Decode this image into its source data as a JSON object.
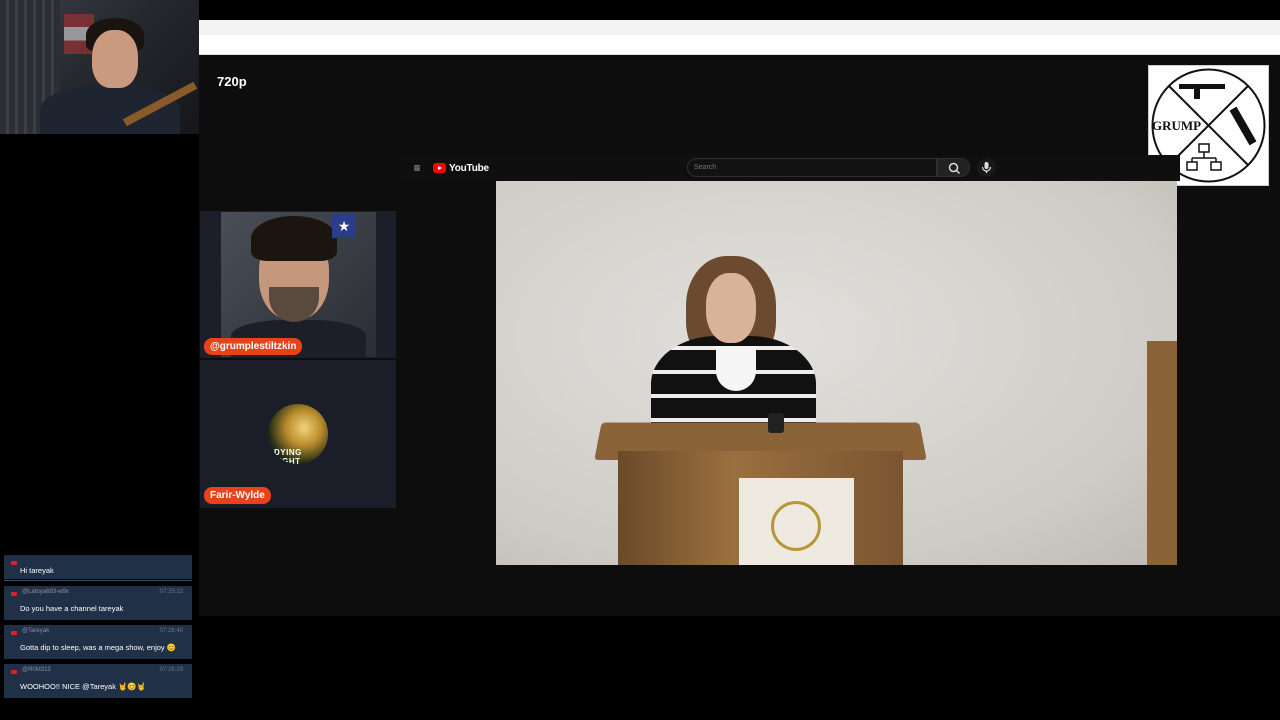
{
  "stream": {
    "quality_label": "720p"
  },
  "logo": {
    "text": "GRUMP"
  },
  "youtube": {
    "brand": "YouTube",
    "search_placeholder": "Search",
    "accent": "#ff0000"
  },
  "guests": [
    {
      "name": "@grumplestiltzkin",
      "avatar_text": ""
    },
    {
      "name": "Farir-Wylde",
      "avatar_text": "DYING LIGHT"
    }
  ],
  "chat": {
    "messages": [
      {
        "user": "",
        "time": "",
        "text": "Hi tareyak"
      },
      {
        "user": "@Latoya693-w9x",
        "time": "07:25:22",
        "text": "Do you have a channel tareyak"
      },
      {
        "user": "@Tareyak",
        "time": "07:26:40",
        "text": "Gotta dip to sleep, was a mega show, enjoy 😊"
      },
      {
        "user": "@R0M313",
        "time": "07:26:29",
        "text": "WOOHOO!! NICE @Tareyak 🤘😊🤘"
      }
    ]
  },
  "colors": {
    "name_tag": "#e8421b",
    "chat_bg": "#1f3047"
  }
}
